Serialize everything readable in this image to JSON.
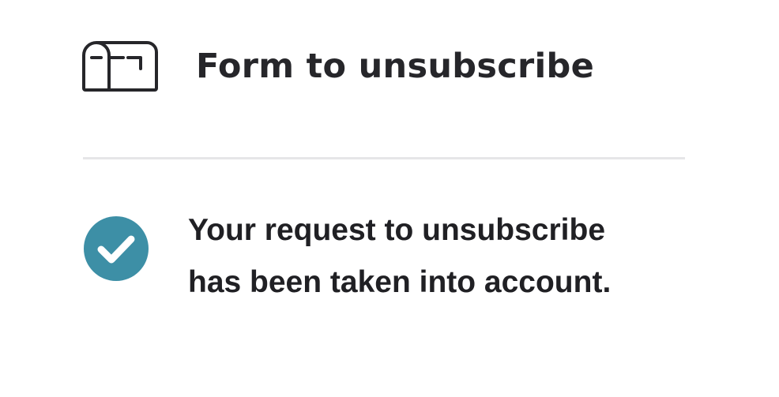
{
  "header": {
    "icon": "mailbox-icon",
    "title": "Form to unsubscribe"
  },
  "confirmation": {
    "icon": "check-circle-icon",
    "icon_color": "#3d8fa6",
    "line1": "Your request to unsubscribe",
    "line2": "has been taken into account."
  },
  "colors": {
    "text": "#26262a",
    "divider": "#e6e6e8"
  }
}
